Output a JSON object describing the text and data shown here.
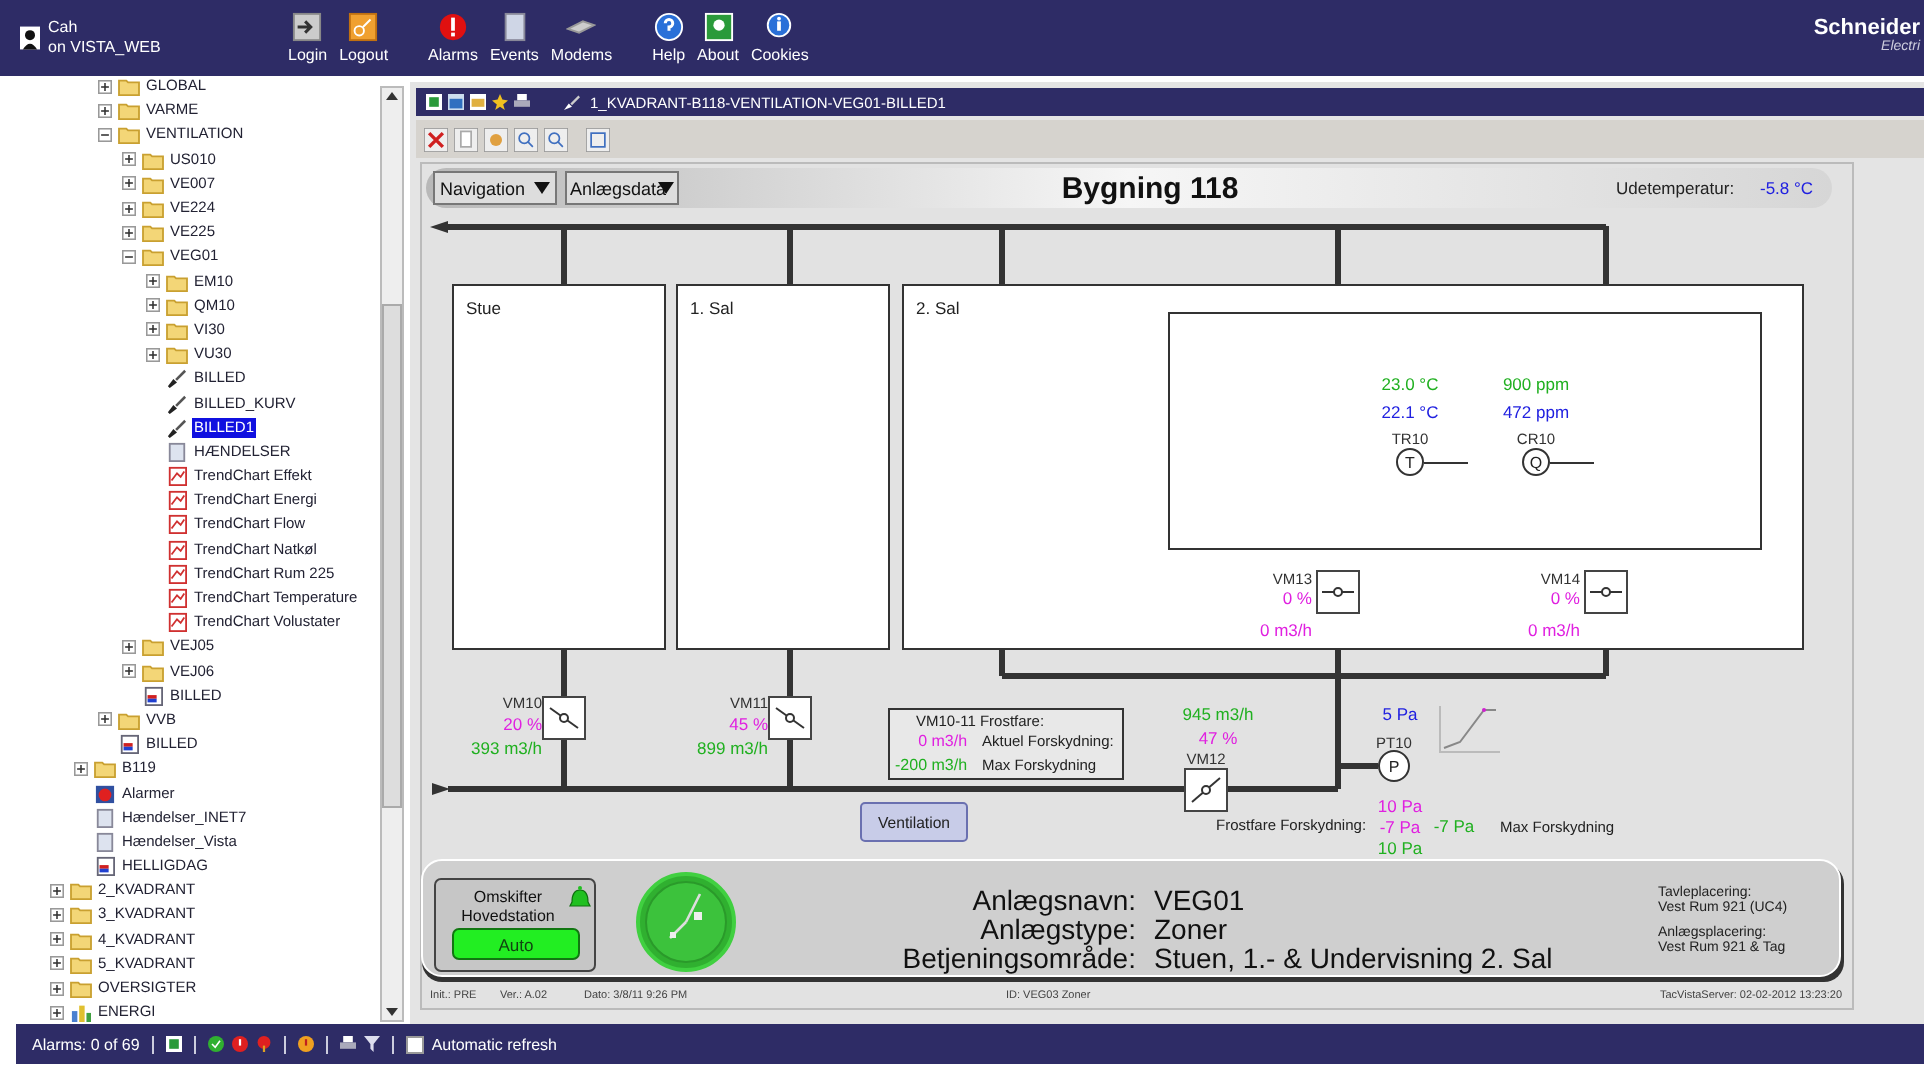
{
  "top_bar": {
    "user": "Cah",
    "server": "on VISTA_WEB",
    "buttons": [
      {
        "label": "Login",
        "kind": "login"
      },
      {
        "label": "Logout",
        "kind": "logout"
      },
      {
        "label": "Alarms",
        "kind": "alarms"
      },
      {
        "label": "Events",
        "kind": "events"
      },
      {
        "label": "Modems",
        "kind": "modems"
      },
      {
        "label": "Help",
        "kind": "help"
      },
      {
        "label": "About",
        "kind": "about"
      },
      {
        "label": "Cookies",
        "kind": "cookies"
      }
    ],
    "logo": [
      "Schneider",
      "Electri"
    ]
  },
  "tree": [
    {
      "children": [
        {
          "children": [
            {
              "label": "GLOBAL",
              "kind": "folder",
              "expanded": false,
              "selected": false
            },
            {
              "label": "VARME",
              "kind": "folder",
              "expanded": false,
              "selected": false
            },
            {
              "label": "VENTILATION",
              "kind": "folder",
              "expanded": true,
              "selected": false,
              "children": [
                {
                  "label": "US010",
                  "kind": "folder",
                  "expanded": false,
                  "selected": false
                },
                {
                  "label": "VE007",
                  "kind": "folder",
                  "expanded": false,
                  "selected": false
                },
                {
                  "label": "VE224",
                  "kind": "folder",
                  "expanded": false,
                  "selected": false
                },
                {
                  "label": "VE225",
                  "kind": "folder",
                  "expanded": false,
                  "selected": false
                },
                {
                  "label": "VEG01",
                  "kind": "folder",
                  "expanded": true,
                  "selected": false,
                  "children": [
                    {
                      "label": "EM10",
                      "kind": "folder",
                      "expanded": false,
                      "selected": false
                    },
                    {
                      "label": "QM10",
                      "kind": "folder",
                      "expanded": false,
                      "selected": false
                    },
                    {
                      "label": "VI30",
                      "kind": "folder",
                      "expanded": false,
                      "selected": false
                    },
                    {
                      "label": "VU30",
                      "kind": "folder",
                      "expanded": false,
                      "selected": false
                    },
                    {
                      "label": "BILLED",
                      "kind": "graphic",
                      "selected": false
                    },
                    {
                      "label": "BILLED_KURV",
                      "kind": "graphic",
                      "selected": false
                    },
                    {
                      "label": "BILLED1",
                      "kind": "graphic",
                      "selected": true
                    },
                    {
                      "label": "HÆNDELSER",
                      "kind": "events",
                      "selected": false
                    },
                    {
                      "label": "TrendChart Effekt",
                      "kind": "trend",
                      "selected": false
                    },
                    {
                      "label": "TrendChart Energi",
                      "kind": "trend",
                      "selected": false
                    },
                    {
                      "label": "TrendChart Flow",
                      "kind": "trend",
                      "selected": false
                    },
                    {
                      "label": "TrendChart Natkøl",
                      "kind": "trend",
                      "selected": false
                    },
                    {
                      "label": "TrendChart Rum 225",
                      "kind": "trend",
                      "selected": false
                    },
                    {
                      "label": "TrendChart Temperature",
                      "kind": "trend",
                      "selected": false
                    },
                    {
                      "label": "TrendChart Volustater",
                      "kind": "trend",
                      "selected": false
                    }
                  ]
                },
                {
                  "label": "VEJ05",
                  "kind": "folder",
                  "expanded": false,
                  "selected": false
                },
                {
                  "label": "VEJ06",
                  "kind": "folder",
                  "expanded": false,
                  "selected": false
                },
                {
                  "label": "BILLED",
                  "kind": "image",
                  "selected": false
                }
              ]
            },
            {
              "label": "VVB",
              "kind": "folder",
              "expanded": false,
              "selected": false
            },
            {
              "label": "BILLED",
              "kind": "image",
              "selected": false
            }
          ]
        },
        {
          "label": "B119",
          "kind": "folder",
          "expanded": false,
          "selected": false
        },
        {
          "label": "Alarmer",
          "kind": "alarm",
          "selected": false
        },
        {
          "label": "Hændelser_INET7",
          "kind": "events",
          "selected": false
        },
        {
          "label": "Hændelser_Vista",
          "kind": "events",
          "selected": false
        },
        {
          "label": "HELLIGDAG",
          "kind": "image",
          "selected": false
        }
      ]
    },
    {
      "label": "2_KVADRANT",
      "kind": "folder",
      "expanded": false,
      "selected": false
    },
    {
      "label": "3_KVADRANT",
      "kind": "folder",
      "expanded": false,
      "selected": false
    },
    {
      "label": "4_KVADRANT",
      "kind": "folder",
      "expanded": false,
      "selected": false
    },
    {
      "label": "5_KVADRANT",
      "kind": "folder",
      "expanded": false,
      "selected": false
    },
    {
      "label": "OVERSIGTER",
      "kind": "folder",
      "expanded": false,
      "selected": false
    },
    {
      "label": "ENERGI",
      "kind": "energy",
      "expanded": false,
      "selected": false
    }
  ],
  "nav_bar": {
    "path": "1_KVADRANT-B118-VENTILATION-VEG01-BILLED1"
  },
  "diagram": {
    "header": {
      "dropdowns": [
        "Navigation",
        "Anlægsdata"
      ],
      "title": "Bygning 118",
      "outdoor_label": "Udetemperatur:",
      "outdoor_value": "-5.8 °C"
    },
    "rooms": [
      "Stue",
      "1. Sal",
      "2. Sal"
    ],
    "sensors": [
      {
        "tag": "TR10",
        "symbol": "T",
        "setpoint": "23.0 °C",
        "actual": "22.1 °C"
      },
      {
        "tag": "CR10",
        "symbol": "Q",
        "setpoint": "900 ppm",
        "actual": "472 ppm"
      }
    ],
    "zone_dampers": [
      {
        "tag": "VM13",
        "percent": "0 %",
        "flow": "0 m3/h"
      },
      {
        "tag": "VM14",
        "percent": "0 %",
        "flow": "0 m3/h"
      }
    ],
    "supply_dampers": [
      {
        "tag": "VM10",
        "percent": "20 %",
        "flow": "393 m3/h"
      },
      {
        "tag": "VM11",
        "percent": "45 %",
        "flow": "899 m3/h"
      }
    ],
    "frost_box": {
      "title": "VM10-11 Frostfare:",
      "rows": [
        {
          "label": "Aktuel Forskydning:",
          "value": "0 m3/h"
        },
        {
          "label": "Max Forskydning",
          "value": "-200 m3/h"
        }
      ]
    },
    "main_damper": {
      "tag": "VM12",
      "flow": "945 m3/h",
      "percent": "47 %"
    },
    "pressure": {
      "tag": "PT10",
      "symbol": "P",
      "value": "5 Pa"
    },
    "ventilation_button": "Ventilation",
    "frost_offset": {
      "label": "Frostfare Forskydning:",
      "values": [
        "10 Pa",
        "-7 Pa",
        "10 Pa"
      ],
      "max_value": "-7 Pa",
      "max_label": "Max Forskydning"
    },
    "info": {
      "switch_label": [
        "Omskifter",
        "Hovedstation"
      ],
      "switch_value": "Auto",
      "fields": [
        {
          "label": "Anlægsnavn:",
          "value": "VEG01"
        },
        {
          "label": "Anlægstype:",
          "value": "Zoner"
        },
        {
          "label": "Betjeningsområde:",
          "value": "Stuen, 1.- & Undervisning 2. Sal"
        }
      ],
      "locations": [
        {
          "label": "Tavleplacering:",
          "value": "Vest Rum 921 (UC4)"
        },
        {
          "label": "Anlægsplacering:",
          "value": "Vest Rum 921 & Tag"
        }
      ]
    },
    "footer": {
      "init": "Init.: PRE",
      "version": "Ver.: A.02",
      "date": "Dato: 3/8/11 9:26 PM",
      "id": "ID: VEG03  Zoner",
      "server_time": "TacVistaServer: 02-02-2012 13:23:20"
    }
  },
  "status_bar": {
    "alarms": "Alarms: 0 of 69",
    "auto_refresh": {
      "label": "Automatic refresh",
      "checked": false
    }
  }
}
